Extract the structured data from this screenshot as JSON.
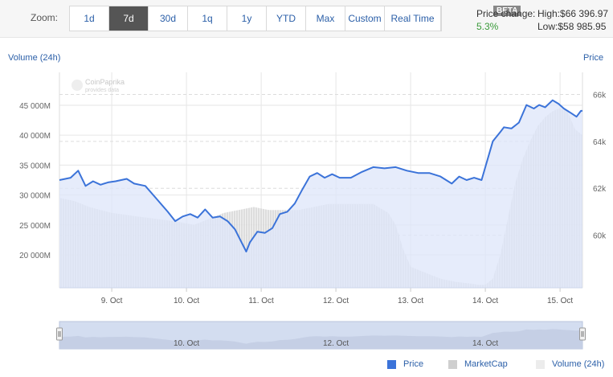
{
  "zoom": {
    "label": "Zoom:",
    "buttons": [
      "1d",
      "7d",
      "30d",
      "1q",
      "1y",
      "YTD",
      "Max",
      "Custom",
      "Real Time"
    ],
    "active_index": 1,
    "beta_badge": "BETA"
  },
  "stats": {
    "price_change_label": "Price change:",
    "price_change_value": "5.3%",
    "high": "High:$66 396.97",
    "low": "Low:$58 985.95"
  },
  "colors": {
    "price": "#3b73d9",
    "marketcap_fill": "#dde6fa",
    "volume": "#d8d8d8",
    "navigator": "#d3ddf0",
    "accent": "#2b5fa8",
    "positive": "#3a9a3a"
  },
  "watermark": {
    "brand": "CoinPaprika",
    "sub": "provides data"
  },
  "legend": {
    "price": "Price",
    "marketcap": "MarketCap",
    "volume": "Volume (24h)"
  },
  "chart_data": {
    "type": "line",
    "left_axis_title": "Volume (24h)",
    "right_axis_title": "Price",
    "left_axis": {
      "ticks": [
        20000,
        25000,
        30000,
        35000,
        40000,
        45000
      ],
      "tick_labels": [
        "20 000M",
        "25 000M",
        "30 000M",
        "35 000M",
        "40 000M",
        "45 000M"
      ],
      "range": [
        14500,
        50500
      ]
    },
    "right_axis": {
      "ticks": [
        60000,
        62000,
        64000,
        66000
      ],
      "tick_labels": [
        "60k",
        "62k",
        "64k",
        "66k"
      ],
      "range": [
        57760,
        66940
      ]
    },
    "x_axis": {
      "range": [
        8.3,
        15.3
      ],
      "ticks": [
        9,
        10,
        11,
        12,
        13,
        14,
        15
      ],
      "tick_labels": [
        "9. Oct",
        "10. Oct",
        "11. Oct",
        "12. Oct",
        "13. Oct",
        "14. Oct",
        "15. Oct"
      ]
    },
    "navigator_labels": [
      {
        "x": 10,
        "label": "10. Oct"
      },
      {
        "x": 12,
        "label": "12. Oct"
      },
      {
        "x": 14,
        "label": "14. Oct"
      }
    ],
    "grid": true,
    "series": [
      {
        "name": "Price",
        "axis": "right",
        "x": [
          8.3,
          8.45,
          8.55,
          8.65,
          8.75,
          8.85,
          8.95,
          9.05,
          9.2,
          9.3,
          9.45,
          9.6,
          9.75,
          9.85,
          9.95,
          10.05,
          10.15,
          10.25,
          10.35,
          10.45,
          10.55,
          10.65,
          10.72,
          10.8,
          10.85,
          10.95,
          11.05,
          11.15,
          11.25,
          11.35,
          11.45,
          11.55,
          11.65,
          11.75,
          11.85,
          11.95,
          12.05,
          12.2,
          12.35,
          12.5,
          12.65,
          12.8,
          12.95,
          13.1,
          13.25,
          13.4,
          13.55,
          13.65,
          13.75,
          13.85,
          13.95,
          14.1,
          14.2,
          14.25,
          14.35,
          14.45,
          14.55,
          14.65,
          14.72,
          14.8,
          14.9,
          14.98,
          15.05,
          15.15,
          15.22,
          15.28,
          15.3
        ],
        "values": [
          62350,
          62450,
          62750,
          62100,
          62300,
          62150,
          62250,
          62300,
          62400,
          62200,
          62100,
          61550,
          61000,
          60600,
          60800,
          60900,
          60750,
          61100,
          60750,
          60800,
          60600,
          60250,
          59800,
          59300,
          59700,
          60150,
          60100,
          60300,
          60900,
          61000,
          61350,
          61950,
          62500,
          62650,
          62450,
          62600,
          62450,
          62450,
          62700,
          62900,
          62850,
          62900,
          62750,
          62650,
          62650,
          62500,
          62200,
          62500,
          62350,
          62450,
          62350,
          64000,
          64400,
          64600,
          64550,
          64800,
          65550,
          65400,
          65550,
          65450,
          65750,
          65600,
          65400,
          65200,
          65050,
          65300,
          65300
        ]
      },
      {
        "name": "MarketCap",
        "axis": "right",
        "x": [
          8.3,
          8.45,
          8.55,
          8.65,
          8.75,
          8.85,
          8.95,
          9.05,
          9.2,
          9.3,
          9.45,
          9.6,
          9.75,
          9.85,
          9.95,
          10.05,
          10.15,
          10.25,
          10.35,
          10.45,
          10.55,
          10.65,
          10.72,
          10.8,
          10.85,
          10.95,
          11.05,
          11.15,
          11.25,
          11.35,
          11.45,
          11.55,
          11.65,
          11.75,
          11.85,
          11.95,
          12.05,
          12.2,
          12.35,
          12.5,
          12.65,
          12.8,
          12.95,
          13.1,
          13.25,
          13.4,
          13.55,
          13.65,
          13.75,
          13.85,
          13.95,
          14.1,
          14.2,
          14.25,
          14.35,
          14.45,
          14.55,
          14.65,
          14.72,
          14.8,
          14.9,
          14.98,
          15.05,
          15.15,
          15.22,
          15.28,
          15.3
        ],
        "values": [
          62350,
          62450,
          62750,
          62100,
          62300,
          62150,
          62250,
          62300,
          62400,
          62200,
          62100,
          61550,
          61000,
          60600,
          60800,
          60900,
          60750,
          61100,
          60750,
          60800,
          60600,
          60250,
          59800,
          59300,
          59700,
          60150,
          60100,
          60300,
          60900,
          61000,
          61350,
          61950,
          62500,
          62650,
          62450,
          62600,
          62450,
          62450,
          62700,
          62900,
          62850,
          62900,
          62750,
          62650,
          62650,
          62500,
          62200,
          62500,
          62350,
          62450,
          62350,
          64000,
          64400,
          64600,
          64550,
          64800,
          65550,
          65400,
          65550,
          65450,
          65750,
          65600,
          65400,
          65200,
          65050,
          65300,
          65300
        ]
      },
      {
        "name": "Volume (24h)",
        "axis": "left",
        "x": [
          8.3,
          8.5,
          8.7,
          9.0,
          9.3,
          9.6,
          9.9,
          10.1,
          10.3,
          10.5,
          10.7,
          10.9,
          11.1,
          11.3,
          11.5,
          11.7,
          11.9,
          12.1,
          12.3,
          12.5,
          12.7,
          12.8,
          12.9,
          13.0,
          13.2,
          13.4,
          13.6,
          13.8,
          13.9,
          14.0,
          14.1,
          14.2,
          14.3,
          14.4,
          14.5,
          14.6,
          14.7,
          14.8,
          14.9,
          15.0,
          15.1,
          15.2,
          15.3
        ],
        "values": [
          29500,
          29000,
          28000,
          27000,
          26500,
          26000,
          25500,
          25000,
          26000,
          27000,
          27500,
          28000,
          27500,
          27500,
          27500,
          28000,
          28500,
          28500,
          28500,
          28500,
          27000,
          25000,
          21000,
          18000,
          17000,
          16000,
          15500,
          15200,
          15000,
          15000,
          16000,
          20000,
          26000,
          32000,
          36000,
          39000,
          41500,
          43000,
          44000,
          44500,
          44000,
          41000,
          40000
        ]
      }
    ]
  }
}
